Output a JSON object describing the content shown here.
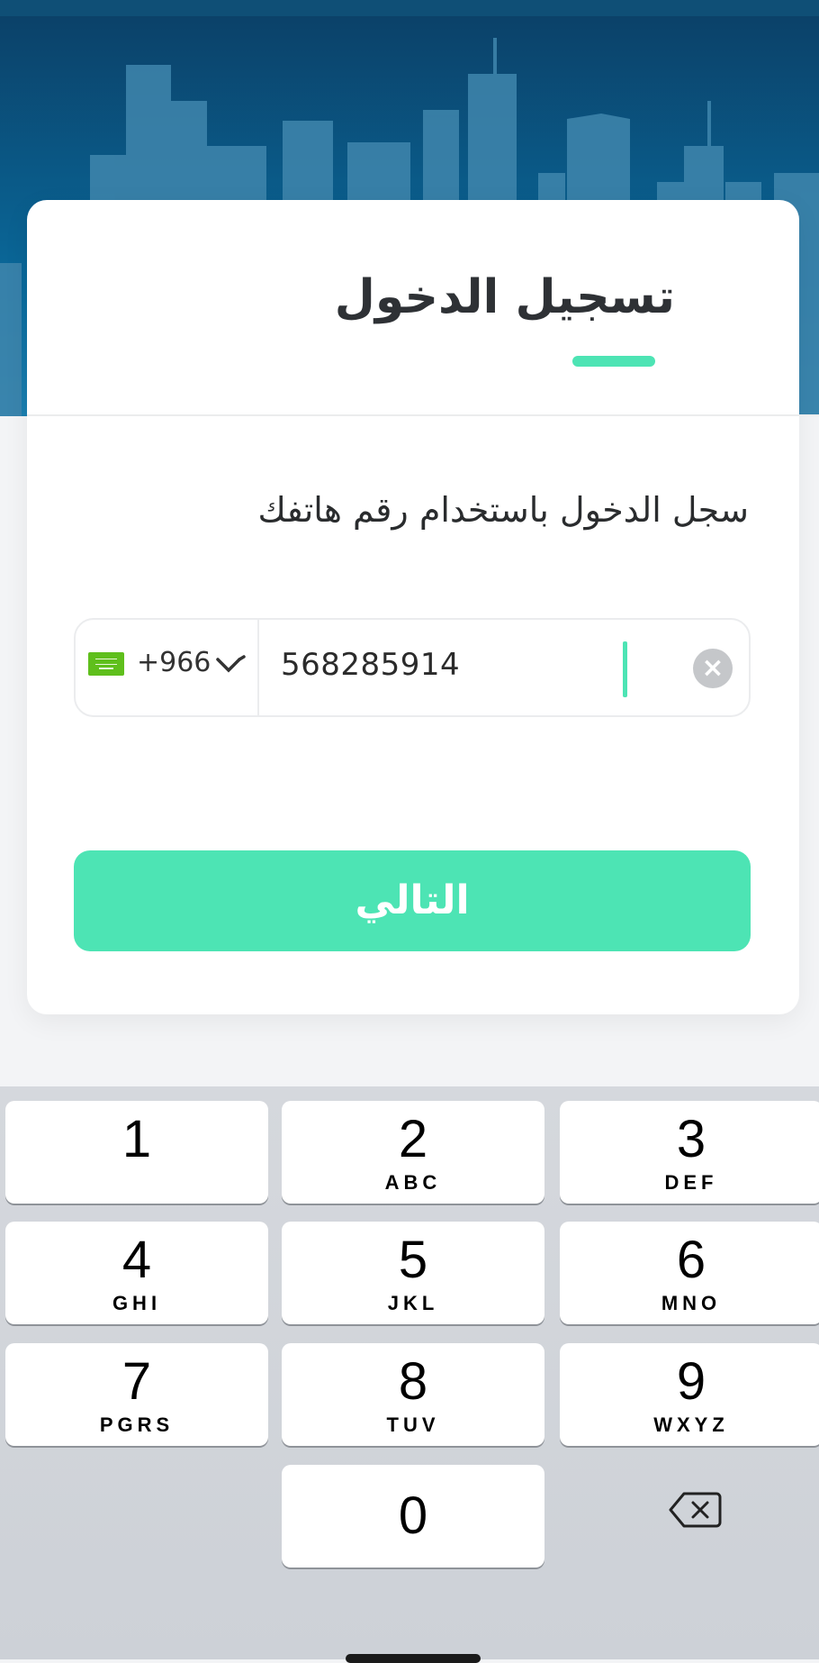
{
  "login": {
    "title": "تسجيل الدخول",
    "subtitle": "سجل الدخول باستخدام رقم هاتفك",
    "country_code": "+966",
    "phone_number": "568285914",
    "next_label": "التالي"
  },
  "keypad": {
    "keys": [
      {
        "num": "1",
        "letters": ""
      },
      {
        "num": "2",
        "letters": "ABC"
      },
      {
        "num": "3",
        "letters": "DEF"
      },
      {
        "num": "4",
        "letters": "GHI"
      },
      {
        "num": "5",
        "letters": "JKL"
      },
      {
        "num": "6",
        "letters": "MNO"
      },
      {
        "num": "7",
        "letters": "PGRS"
      },
      {
        "num": "8",
        "letters": "TUV"
      },
      {
        "num": "9",
        "letters": "WXYZ"
      },
      {
        "num": "0",
        "letters": ""
      }
    ]
  },
  "colors": {
    "accent": "#4de4b4",
    "header_blue": "#0a6a9c",
    "flag_green": "#5fbf1c"
  }
}
